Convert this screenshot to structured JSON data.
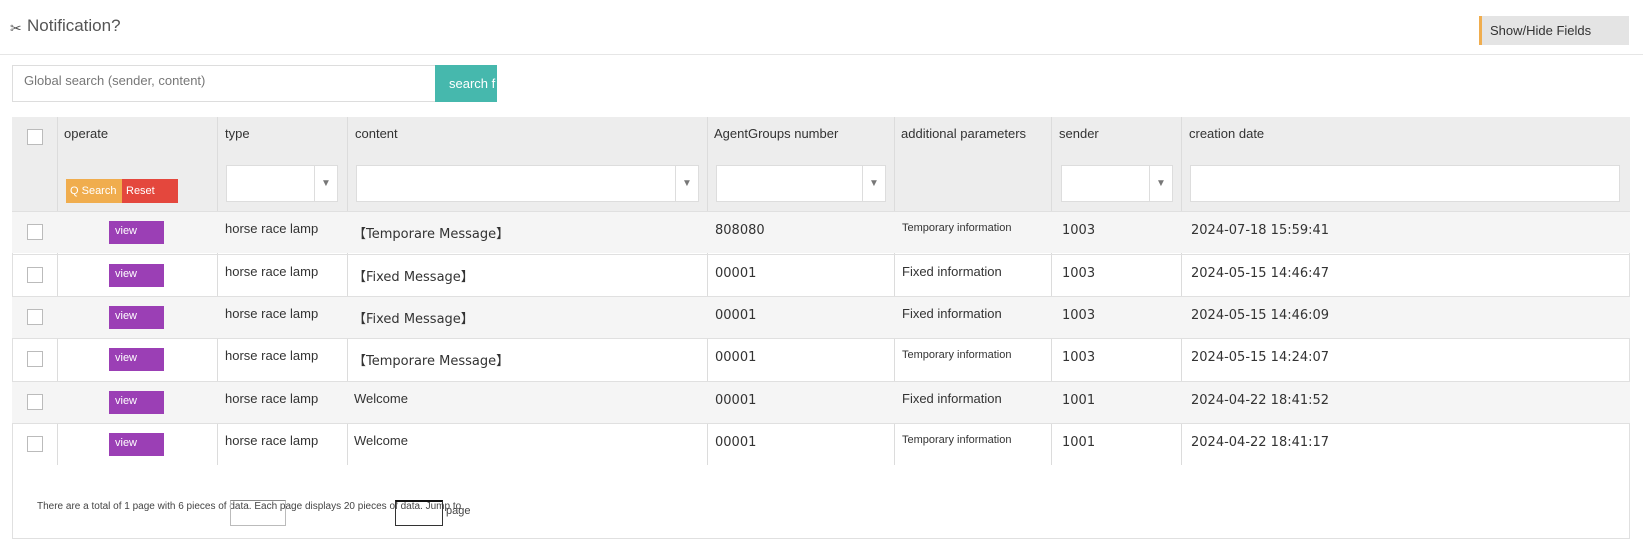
{
  "header": {
    "icon": "megaphone-icon",
    "title": "Notification?",
    "show_hide_label": "Show/Hide Fields"
  },
  "search": {
    "placeholder": "Global search (sender, content)",
    "button_label": "search f"
  },
  "table": {
    "columns": [
      "operate",
      "type",
      "content",
      "AgentGroups number",
      "additional parameters",
      "sender",
      "creation date"
    ],
    "filter_search_label": "Q Search",
    "filter_reset_label": "Reset",
    "view_label": "view",
    "rows": [
      {
        "type": "horse race lamp",
        "content": "【Temporare Message】",
        "agent_groups": "808080",
        "additional": "Temporary information",
        "sender": "1003",
        "created": "2024-07-18 15:59:41"
      },
      {
        "type": "horse race lamp",
        "content": "【Fixed Message】",
        "agent_groups": "00001",
        "additional": "Fixed information",
        "sender": "1003",
        "created": "2024-05-15 14:46:47"
      },
      {
        "type": "horse race lamp",
        "content": "【Fixed Message】",
        "agent_groups": "00001",
        "additional": "Fixed information",
        "sender": "1003",
        "created": "2024-05-15 14:46:09"
      },
      {
        "type": "horse race lamp",
        "content": "【Temporare Message】",
        "agent_groups": "00001",
        "additional": "Temporary information",
        "sender": "1003",
        "created": "2024-05-15 14:24:07"
      },
      {
        "type": "horse race lamp",
        "content": "Welcome",
        "agent_groups": "00001",
        "additional": "Fixed information",
        "sender": "1001",
        "created": "2024-04-22 18:41:52"
      },
      {
        "type": "horse race lamp",
        "content": "Welcome",
        "agent_groups": "00001",
        "additional": "Temporary information",
        "sender": "1001",
        "created": "2024-04-22 18:41:17"
      }
    ]
  },
  "footer": {
    "summary": "There are a total of 1 page with 6 pieces of data. Each page displays 20 pieces of data. Jump to",
    "page_label": "page"
  },
  "colors": {
    "accent_teal": "#46b8ad",
    "view_purple": "#9b3fb5",
    "search_orange": "#f0ad4e",
    "reset_red": "#e4473d"
  }
}
